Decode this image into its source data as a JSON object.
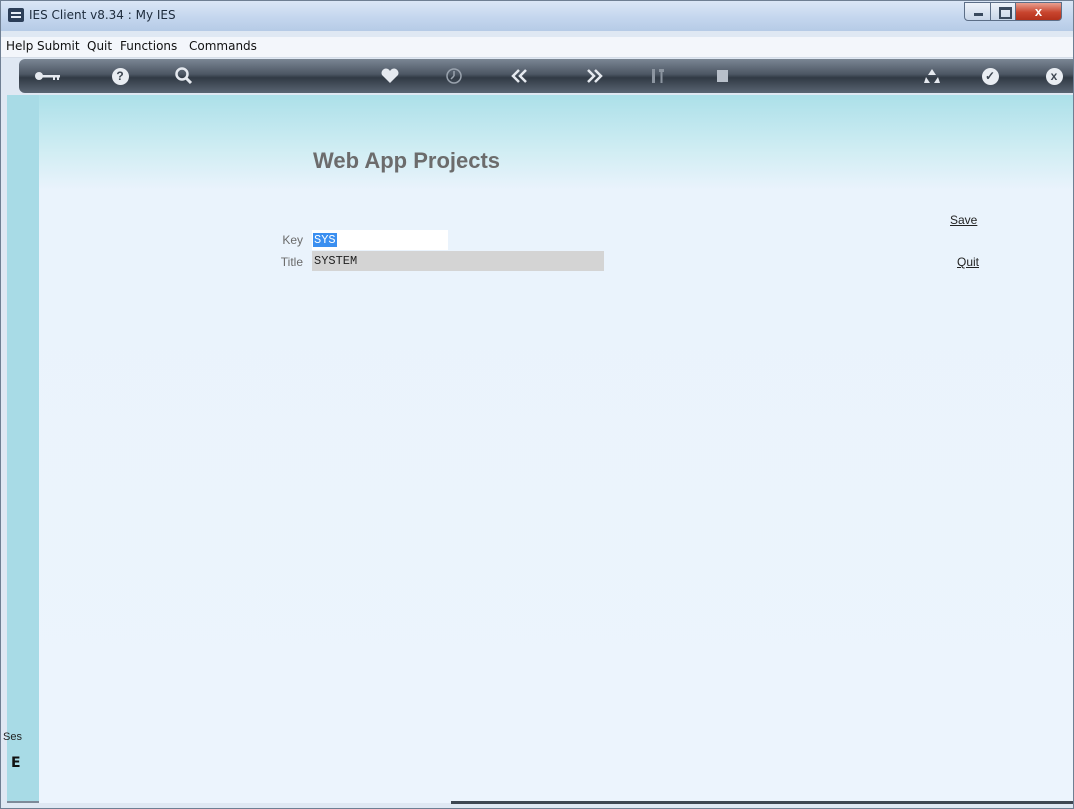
{
  "window": {
    "title": "IES Client v8.34 : My IES",
    "close_glyph": "x"
  },
  "menu": [
    "Help",
    "Submit",
    "Quit",
    "Functions",
    "Commands"
  ],
  "toolbar": {
    "icons": [
      "key-icon",
      "help-icon",
      "search-icon",
      "heart-icon",
      "clock-icon",
      "rewind-icon",
      "forward-icon",
      "tools-icon",
      "stop-icon",
      "recycle-icon",
      "check-icon",
      "close-icon"
    ],
    "help_glyph": "?",
    "check_glyph": "✓",
    "close_glyph": "x"
  },
  "page": {
    "title": "Web App Projects"
  },
  "form": {
    "key_label": "Key",
    "key_value": "SYS",
    "title_label": "Title",
    "title_value": "SYSTEM"
  },
  "actions": {
    "save": "Save",
    "quit": "Quit"
  },
  "session": {
    "label": "Ses",
    "glyph": "E"
  }
}
